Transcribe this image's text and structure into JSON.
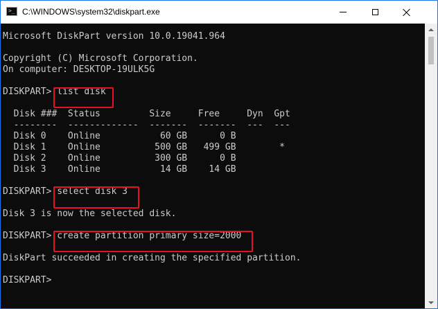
{
  "window": {
    "title": "C:\\WINDOWS\\system32\\diskpart.exe",
    "prompt_glyph": ">_"
  },
  "console": {
    "lines": [
      "Microsoft DiskPart version 10.0.19041.964",
      "",
      "Copyright (C) Microsoft Corporation.",
      "On computer: DESKTOP-19ULK5G",
      "",
      "DISKPART> list disk",
      "",
      "  Disk ###  Status         Size     Free     Dyn  Gpt",
      "  --------  -------------  -------  -------  ---  ---",
      "  Disk 0    Online           60 GB      0 B",
      "  Disk 1    Online          500 GB   499 GB        *",
      "  Disk 2    Online          300 GB      0 B",
      "  Disk 3    Online           14 GB    14 GB",
      "",
      "DISKPART> select disk 3",
      "",
      "Disk 3 is now the selected disk.",
      "",
      "DISKPART> create partition primary size=2000",
      "",
      "DiskPart succeeded in creating the specified partition.",
      "",
      "DISKPART> "
    ]
  },
  "colors": {
    "console_bg": "#0c0c0c",
    "console_text": "#cccccc",
    "highlight_border": "#e81123",
    "window_border": "#1a73e8"
  },
  "icons": {
    "app": "console-icon",
    "minimize": "minimize-icon",
    "maximize": "maximize-icon",
    "close": "close-icon",
    "scroll_up": "scroll-up-arrow-icon",
    "scroll_down": "scroll-down-arrow-icon"
  }
}
